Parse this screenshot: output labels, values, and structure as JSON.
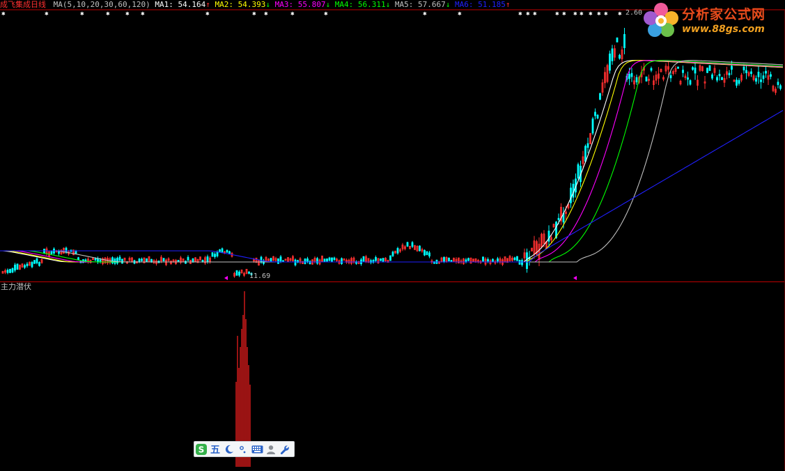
{
  "header": {
    "title": "成飞集成",
    "period": "日线",
    "ma_label": "MA(5,10,20,30,60,120)",
    "ma_values": [
      {
        "label": "MA1:",
        "value": "54.164",
        "arrow": "↑",
        "color": "#ffffff"
      },
      {
        "label": "MA2:",
        "value": "54.393",
        "arrow": "↓",
        "color": "#ffff00"
      },
      {
        "label": "MA3:",
        "value": "55.807",
        "arrow": "↓",
        "color": "#ff00ff"
      },
      {
        "label": "MA4:",
        "value": "56.311",
        "arrow": "↓",
        "color": "#00ff00"
      },
      {
        "label": "MA5:",
        "value": "57.667",
        "arrow": "↓",
        "color": "#c0c0c0"
      },
      {
        "label": "MA6:",
        "value": "51.185",
        "arrow": "↑",
        "color": "#2020ff"
      }
    ]
  },
  "main_chart": {
    "high_label": "2.60",
    "low_label": "11.69"
  },
  "sub_chart": {
    "title": "主力潜伏",
    "color": "#ff2020"
  },
  "logo": {
    "name": "分析家公式网",
    "url": "www.88gs.com"
  },
  "ime": {
    "label_wu": "五",
    "icons": [
      "sogou-icon",
      "moon-icon",
      "punctuation-icon",
      "keyboard-icon",
      "user-icon",
      "wrench-icon"
    ]
  },
  "colors": {
    "background": "#000000",
    "up": "#ff3030",
    "down": "#00ffff",
    "divider": "#c00000"
  }
}
